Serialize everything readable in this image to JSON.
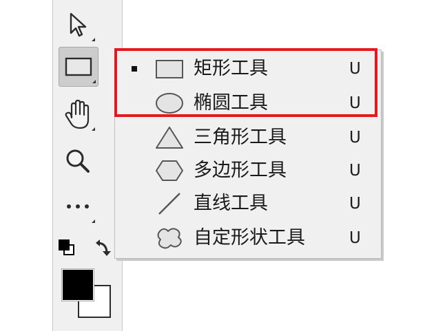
{
  "toolbar": {
    "tools": [
      {
        "name": "move-tool",
        "icon": "arrow-pointer-icon"
      },
      {
        "name": "rectangle-tool",
        "icon": "rectangle-icon",
        "active": true
      },
      {
        "name": "hand-tool",
        "icon": "hand-icon"
      },
      {
        "name": "zoom-tool",
        "icon": "magnifier-icon"
      },
      {
        "name": "more-tools",
        "icon": "ellipsis-icon"
      }
    ],
    "foreground_color": "#000000",
    "background_color": "#ffffff"
  },
  "flyout": {
    "items": [
      {
        "label": "矩形工具",
        "shortcut": "U",
        "icon": "rectangle-icon",
        "selected": true
      },
      {
        "label": "椭圆工具",
        "shortcut": "U",
        "icon": "ellipse-icon",
        "selected": false
      },
      {
        "label": "三角形工具",
        "shortcut": "U",
        "icon": "triangle-icon",
        "selected": false
      },
      {
        "label": "多边形工具",
        "shortcut": "U",
        "icon": "polygon-icon",
        "selected": false
      },
      {
        "label": "直线工具",
        "shortcut": "U",
        "icon": "line-icon",
        "selected": false
      },
      {
        "label": "自定形状工具",
        "shortcut": "U",
        "icon": "custom-shape-icon",
        "selected": false
      }
    ]
  },
  "colors": {
    "highlight": "#e3191f",
    "panel": "#f0f0f0",
    "active_tool": "#cdcdcd"
  }
}
